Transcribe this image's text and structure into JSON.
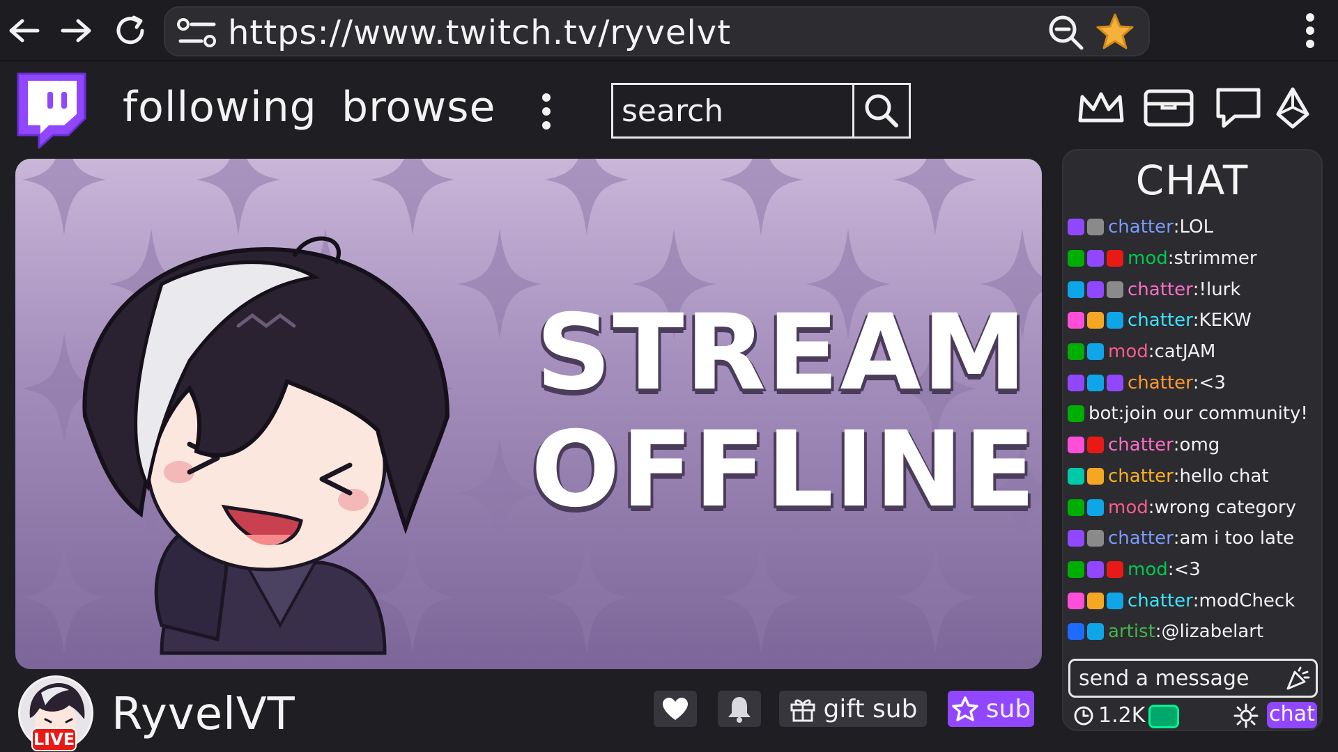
{
  "browser": {
    "url": "https://www.twitch.tv/ryvelvt",
    "icons": [
      "back-arrow-icon",
      "forward-arrow-icon",
      "reload-icon",
      "site-settings-icon",
      "zoom-out-icon",
      "bookmark-star-icon",
      "kebab-menu-icon"
    ]
  },
  "nav": {
    "following_label": "following",
    "browse_label": "browse",
    "search_placeholder": "search",
    "icons": [
      "twitch-logo-icon",
      "crown-icon",
      "inbox-icon",
      "whisper-icon",
      "bits-icon"
    ]
  },
  "player": {
    "offline_line1": "STREAM",
    "offline_line2": "OFFLINE"
  },
  "channel": {
    "name": "RyvelVT",
    "live_label": "LIVE",
    "gift_sub_label": "gift sub",
    "sub_label": "sub"
  },
  "chat": {
    "title": "CHAT",
    "messages": [
      {
        "badges": [
          "#9147ff",
          "#8a8a8a"
        ],
        "user": "chatter",
        "user_color": "#7b9bff",
        "text": "LOL"
      },
      {
        "badges": [
          "#00ad03",
          "#9147ff",
          "#e91916"
        ],
        "user": "mod",
        "user_color": "#00c94e",
        "text": "strimmer"
      },
      {
        "badges": [
          "#0ea5e9",
          "#9147ff",
          "#8a8a8a"
        ],
        "user": "chatter",
        "user_color": "#ff6ec7",
        "text": "!lurk"
      },
      {
        "badges": [
          "#ff4fd8",
          "#f5a623",
          "#0ea5e9"
        ],
        "user": "chatter",
        "user_color": "#3de3ff",
        "text": "KEKW"
      },
      {
        "badges": [
          "#00ad03",
          "#0ea5e9"
        ],
        "user": "mod",
        "user_color": "#ff5c8a",
        "text": "catJAM"
      },
      {
        "badges": [
          "#9147ff",
          "#0ea5e9",
          "#9147ff"
        ],
        "user": "chatter",
        "user_color": "#ff9a2e",
        "text": "<3"
      },
      {
        "badges": [
          "#00ad03"
        ],
        "user": "bot",
        "user_color": "#f2f2f2",
        "text": "join our community!"
      },
      {
        "badges": [
          "#ff4fd8",
          "#e91916"
        ],
        "user": "chatter",
        "user_color": "#ff6ec7",
        "text": "omg"
      },
      {
        "badges": [
          "#00c9a7",
          "#f5a623"
        ],
        "user": "chatter",
        "user_color": "#ffb020",
        "text": "hello chat"
      },
      {
        "badges": [
          "#00ad03",
          "#0ea5e9"
        ],
        "user": "mod",
        "user_color": "#ff5c8a",
        "text": "wrong category"
      },
      {
        "badges": [
          "#9147ff",
          "#8a8a8a"
        ],
        "user": "chatter",
        "user_color": "#7b9bff",
        "text": "am i too late"
      },
      {
        "badges": [
          "#00ad03",
          "#9147ff",
          "#e91916"
        ],
        "user": "mod",
        "user_color": "#00c94e",
        "text": "<3"
      },
      {
        "badges": [
          "#ff4fd8",
          "#f5a623",
          "#0ea5e9"
        ],
        "user": "chatter",
        "user_color": "#3de3ff",
        "text": "modCheck"
      },
      {
        "badges": [
          "#1e6bff",
          "#0ea5e9"
        ],
        "user": "artist",
        "user_color": "#44b549",
        "text": "@lizabelart"
      }
    ],
    "input_placeholder": "send a message",
    "viewer_count": "1.2K",
    "send_label": "chat"
  },
  "colors": {
    "twitch_purple": "#9147ff",
    "live_red": "#e91916",
    "player_top": "#c9b6d8",
    "player_bottom": "#7c6699"
  }
}
